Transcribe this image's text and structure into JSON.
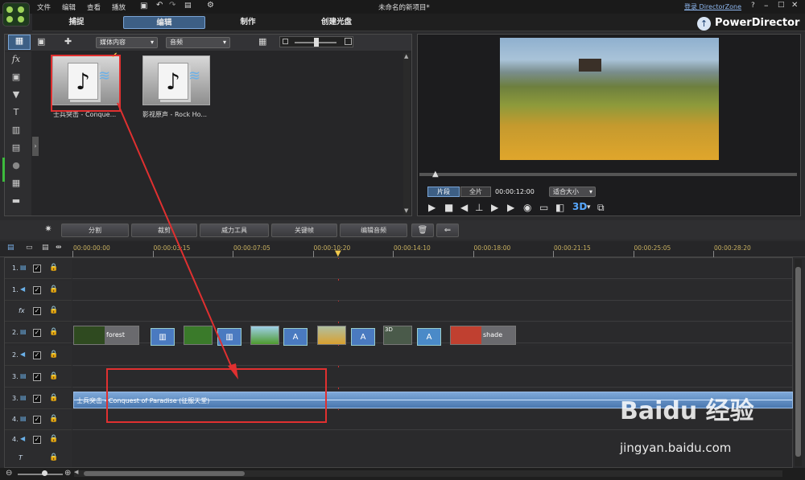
{
  "menu": {
    "items": [
      "文件",
      "编辑",
      "查看",
      "播放"
    ]
  },
  "window": {
    "title": "未命名的新项目*",
    "directorzone": "登录 DirectorZone",
    "help": "?",
    "app_name": "PowerDirector"
  },
  "tabs": {
    "capture": "捕捉",
    "edit": "编辑",
    "produce": "制作",
    "disc": "创建光盘"
  },
  "library": {
    "filter_label": "媒体内容",
    "type_label": "音频",
    "items": [
      {
        "label": "士兵突击 - Conque..."
      },
      {
        "label": "影视原声 - Rock Ho..."
      }
    ]
  },
  "preview": {
    "mode_clip": "片段",
    "mode_full": "全片",
    "timecode": "00:00:12:00",
    "fit_label": "适合大小",
    "three_d": "3D"
  },
  "edit_toolbar": {
    "split": "分割",
    "trim": "裁剪",
    "power_tools": "威力工具",
    "keyframe": "关键帧",
    "edit_audio": "编辑音频"
  },
  "ruler": {
    "labels": [
      "00:00:00:00",
      "00:00:03:15",
      "00:00:07:05",
      "00:00:10:20",
      "00:00:14:10",
      "00:00:18:00",
      "00:00:21:15",
      "00:00:25:05",
      "00:00:28:20"
    ]
  },
  "tracks": [
    {
      "label": "1."
    },
    {
      "label": "1."
    },
    {
      "label": "fx"
    },
    {
      "label": "2."
    },
    {
      "label": "2."
    },
    {
      "label": "3."
    },
    {
      "label": "3."
    },
    {
      "label": "4."
    },
    {
      "label": "4."
    },
    {
      "label": "T"
    }
  ],
  "clips": {
    "forest": "forest",
    "shade": "shade",
    "three_d": "3D",
    "audio": "士兵突击 - Conquest of Paradise (征服天堂)"
  },
  "watermark": {
    "brand": "Baidu 经验",
    "url": "jingyan.baidu.com"
  },
  "colors": {
    "accent": "#3d5f85",
    "annotation": "#e03030",
    "audio_clip": "#5a88c0",
    "playhead": "#d03030"
  }
}
